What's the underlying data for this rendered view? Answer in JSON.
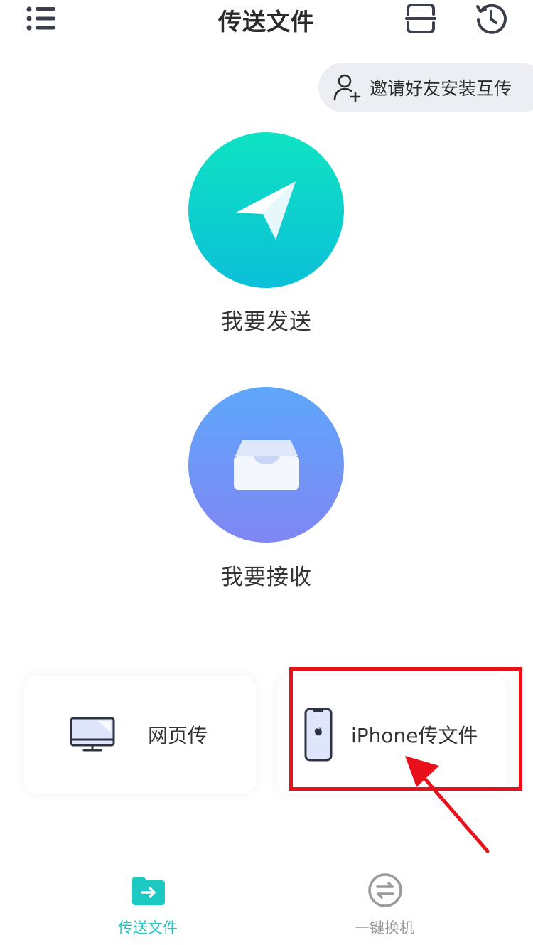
{
  "header": {
    "title": "传送文件",
    "menu_icon": "list-menu-icon",
    "scan_icon": "scan-icon",
    "history_icon": "history-icon"
  },
  "invite": {
    "label": "邀请好友安装互传",
    "icon": "add-user-icon"
  },
  "actions": {
    "send": {
      "label": "我要发送",
      "icon": "paper-plane-icon",
      "color": "#0fe3c3"
    },
    "receive": {
      "label": "我要接收",
      "icon": "inbox-tray-icon",
      "color": "#6f97f8"
    }
  },
  "cards": [
    {
      "label": "网页传",
      "icon": "monitor-icon"
    },
    {
      "label": "iPhone传文件",
      "icon": "iphone-icon"
    }
  ],
  "annotation": {
    "color": "#e8101b"
  },
  "bottom_nav": [
    {
      "label": "传送文件",
      "icon": "folder-transfer-icon",
      "active": true,
      "color": "#1cc9c2"
    },
    {
      "label": "一键换机",
      "icon": "switch-icon",
      "active": false,
      "color": "#9a9a9a"
    }
  ]
}
